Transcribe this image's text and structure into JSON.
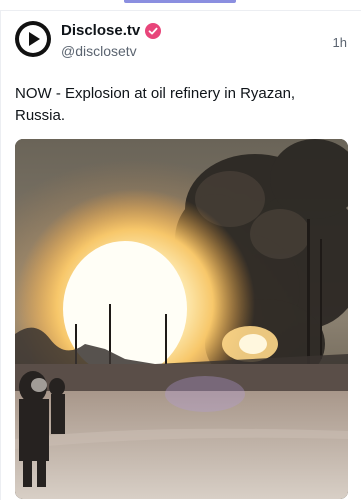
{
  "post": {
    "author": {
      "display_name": "Disclose.tv",
      "handle": "@disclosetv",
      "verified": true,
      "avatar_icon": "play-logo-icon"
    },
    "timestamp": "1h",
    "text": "NOW - Explosion at oil refinery in Ryazan, Russia.",
    "media": {
      "type": "video-frame"
    }
  },
  "colors": {
    "verified_badge": "#e8457a",
    "tab_indicator": "#8b8fe0",
    "text_primary": "#0f1419",
    "text_secondary": "#5b6470"
  }
}
